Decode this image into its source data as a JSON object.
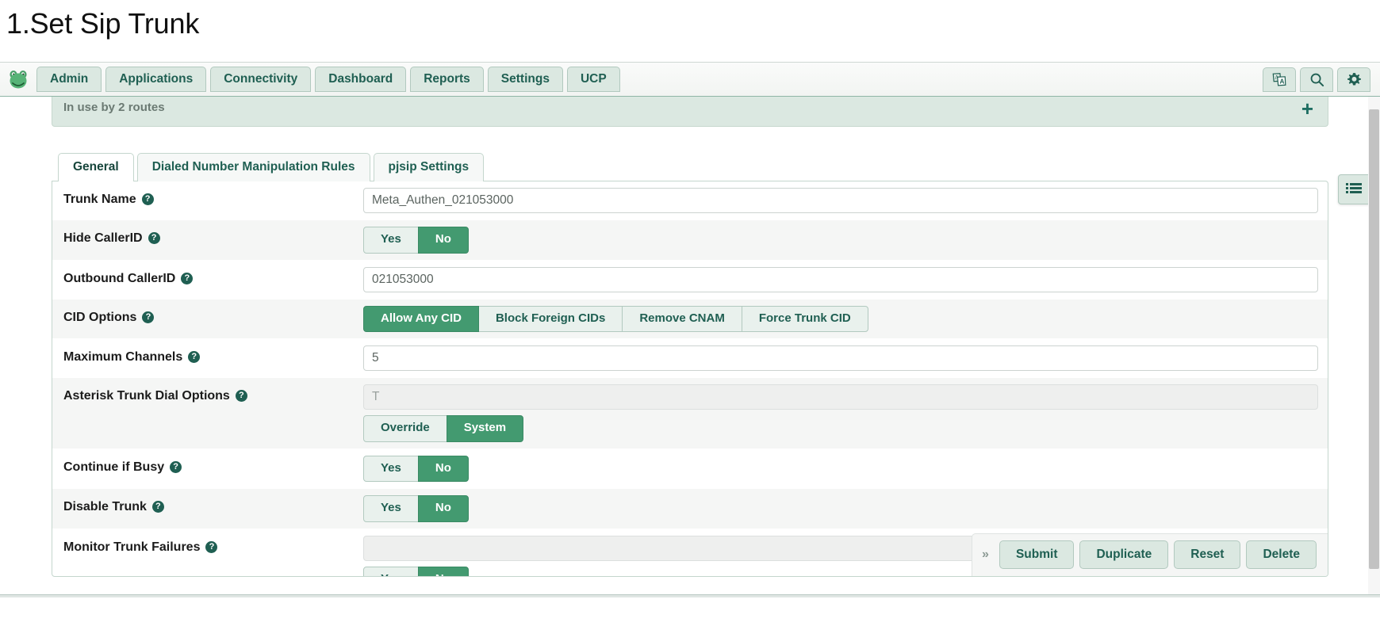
{
  "page": {
    "heading": "1.Set Sip Trunk"
  },
  "navbar": {
    "logo_icon": "frog-logo-icon",
    "items": [
      {
        "label": "Admin",
        "name": "nav-item-admin"
      },
      {
        "label": "Applications",
        "name": "nav-item-applications"
      },
      {
        "label": "Connectivity",
        "name": "nav-item-connectivity"
      },
      {
        "label": "Dashboard",
        "name": "nav-item-dashboard"
      },
      {
        "label": "Reports",
        "name": "nav-item-reports"
      },
      {
        "label": "Settings",
        "name": "nav-item-settings"
      },
      {
        "label": "UCP",
        "name": "nav-item-ucp"
      }
    ],
    "right_icons": [
      {
        "name": "language-translate-icon"
      },
      {
        "name": "search-icon"
      },
      {
        "name": "gear-icon"
      }
    ]
  },
  "inuse_panel": {
    "text": "In use by 2 routes",
    "add_label": "+"
  },
  "tabs": [
    {
      "label": "General",
      "active": true
    },
    {
      "label": "Dialed Number Manipulation Rules",
      "active": false
    },
    {
      "label": "pjsip Settings",
      "active": false
    }
  ],
  "form": {
    "rows": [
      {
        "label": "Trunk Name",
        "type": "text",
        "value": "Meta_Authen_021053000",
        "disabled": false
      },
      {
        "label": "Hide CallerID",
        "type": "buttons",
        "options": [
          "Yes",
          "No"
        ],
        "selected": "No"
      },
      {
        "label": "Outbound CallerID",
        "type": "text",
        "value": "021053000",
        "disabled": false
      },
      {
        "label": "CID Options",
        "type": "buttons",
        "options": [
          "Allow Any CID",
          "Block Foreign CIDs",
          "Remove CNAM",
          "Force Trunk CID"
        ],
        "selected": "Allow Any CID"
      },
      {
        "label": "Maximum Channels",
        "type": "text",
        "value": "5",
        "disabled": false
      },
      {
        "label": "Asterisk Trunk Dial Options",
        "type": "text_with_buttons",
        "value": "T",
        "disabled": true,
        "options": [
          "Override",
          "System"
        ],
        "selected": "System"
      },
      {
        "label": "Continue if Busy",
        "type": "buttons",
        "options": [
          "Yes",
          "No"
        ],
        "selected": "No"
      },
      {
        "label": "Disable Trunk",
        "type": "buttons",
        "options": [
          "Yes",
          "No"
        ],
        "selected": "No"
      },
      {
        "label": "Monitor Trunk Failures",
        "type": "text_with_buttons",
        "value": "",
        "disabled": true,
        "options": [
          "Yes",
          "No"
        ],
        "selected": "No"
      }
    ],
    "help_glyph": "?"
  },
  "actionbar": {
    "expand_label": "»",
    "buttons": [
      {
        "label": "Submit",
        "name": "submit-button"
      },
      {
        "label": "Duplicate",
        "name": "duplicate-button"
      },
      {
        "label": "Reset",
        "name": "reset-button"
      },
      {
        "label": "Delete",
        "name": "delete-button"
      }
    ]
  },
  "side_tab": {
    "icon": "list-panel-icon"
  },
  "colors": {
    "accent_green": "#439a70",
    "nav_text": "#1f5f52",
    "nav_button_bg": "#dbe8e1",
    "panel_border": "#c4d6cd",
    "row_alt_bg": "#f5f6f5"
  }
}
